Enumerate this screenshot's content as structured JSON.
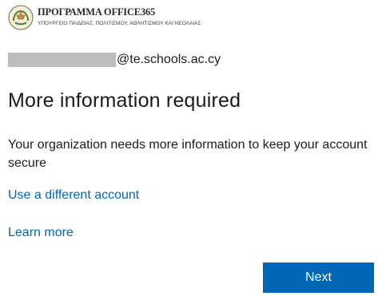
{
  "banner": {
    "title": "ΠΡΟΓΡΑΜΜΑ OFFICE365",
    "subtitle": "ΥΠΟΥΡΓΕΙΟ ΠΑΙΔΕΙΑΣ, ΠΟΛΙΤΙΣΜΟΥ, ΑΘΛΗΤΙΣΜΟΥ ΚΑΙ ΝΕΟΛΑΙΑΣ",
    "seal_icon": "coat-of-arms-icon"
  },
  "identity": {
    "domain": "@te.schools.ac.cy"
  },
  "main": {
    "title": "More information required",
    "description": "Your organization needs more information to keep your account secure",
    "use_different_account": "Use a different account",
    "learn_more": "Learn more",
    "next_label": "Next"
  },
  "colors": {
    "accent": "#0067b8",
    "text": "#1b1b1b",
    "redaction": "#bdbdbd"
  }
}
